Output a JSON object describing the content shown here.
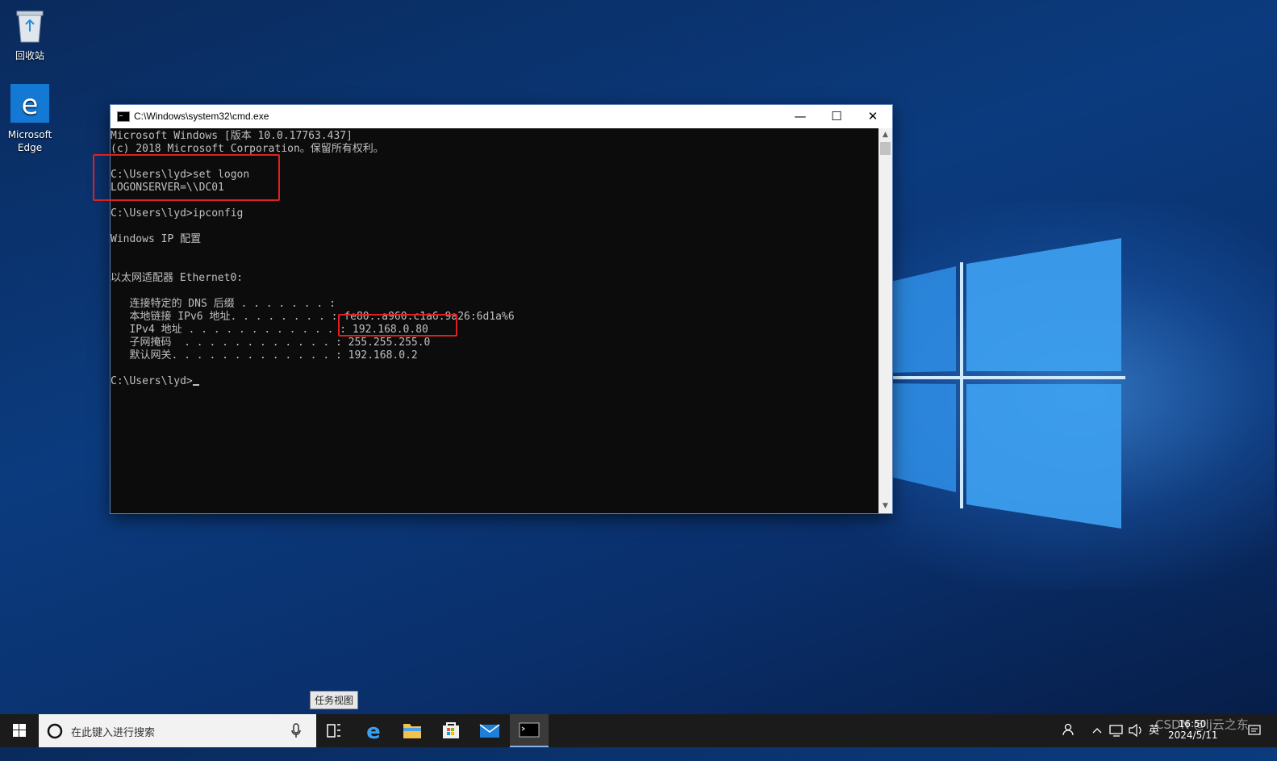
{
  "desktop": {
    "icons": [
      {
        "label": "回收站",
        "icon": "recycle-bin-icon"
      },
      {
        "label": "Microsoft Edge",
        "icon": "edge-icon"
      }
    ]
  },
  "cmd": {
    "title": "C:\\Windows\\system32\\cmd.exe",
    "controls": {
      "minimize": "—",
      "maximize": "☐",
      "close": "✕"
    },
    "lines": [
      "Microsoft Windows [版本 10.0.17763.437]",
      "(c) 2018 Microsoft Corporation。保留所有权利。",
      "",
      "C:\\Users\\lyd>set logon",
      "LOGONSERVER=\\\\DC01",
      "",
      "C:\\Users\\lyd>ipconfig",
      "",
      "Windows IP 配置",
      "",
      "",
      "以太网适配器 Ethernet0:",
      "",
      "   连接特定的 DNS 后缀 . . . . . . . :",
      "   本地链接 IPv6 地址. . . . . . . . : fe80::a960:c1a6:9a26:6d1a%6",
      "   IPv4 地址 . . . . . . . . . . . . : 192.168.0.80",
      "   子网掩码  . . . . . . . . . . . . : 255.255.255.0",
      "   默认网关. . . . . . . . . . . . . : 192.168.0.2",
      "",
      "C:\\Users\\lyd>"
    ]
  },
  "taskbar": {
    "search_placeholder": "在此键入进行搜索",
    "tooltip": "任务视图",
    "apps": [
      "task-view-icon",
      "edge-icon",
      "file-explorer-icon",
      "store-icon",
      "mail-icon",
      "cmd-icon"
    ],
    "tray": {
      "ime": "英",
      "time": "16:50",
      "date": "2024/5/11"
    }
  },
  "watermark": "CSDN @lj云之东",
  "colors": {
    "console_bg": "#0c0c0c",
    "console_text": "#c0c0c0",
    "highlight": "#e02020",
    "taskbar": "#1b1b1b"
  }
}
